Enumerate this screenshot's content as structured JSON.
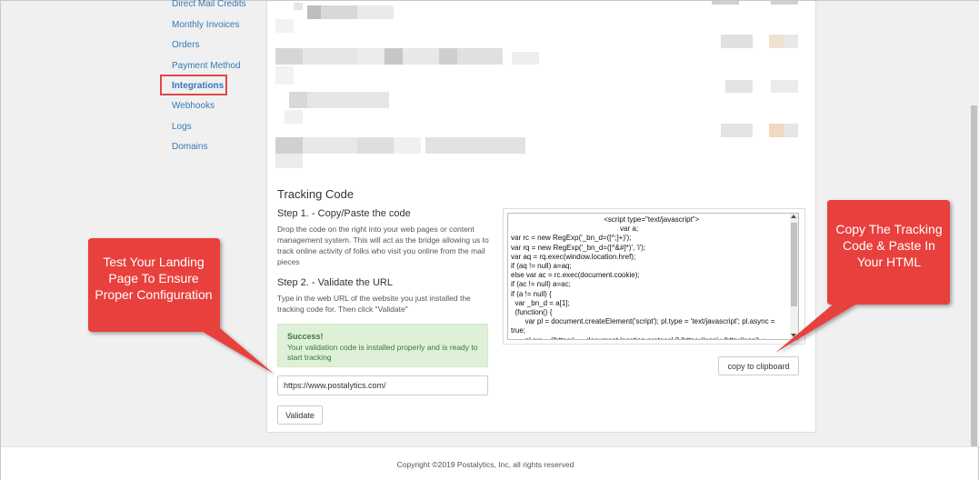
{
  "sidebar": {
    "items": [
      {
        "label": "Direct Mail Credits"
      },
      {
        "label": "Monthly Invoices"
      },
      {
        "label": "Orders"
      },
      {
        "label": "Payment Method"
      },
      {
        "label": "Integrations",
        "active": true
      },
      {
        "label": "Webhooks"
      },
      {
        "label": "Logs"
      },
      {
        "label": "Domains"
      }
    ]
  },
  "tracking": {
    "title": "Tracking Code",
    "step1_title": "Step 1. - Copy/Paste the code",
    "step1_desc": "Drop the code on the right into your web pages or content management system. This will act as the bridge allowing us to track online activity of folks who visit you online from the mail pieces",
    "step2_title": "Step 2. - Validate the URL",
    "step2_desc": "Type in the web URL of the website you just installed the tracking code for. Then click \"Validate\"",
    "success_title": "Success!",
    "success_text": "Your validation code is installed properly and is ready to start tracking",
    "url_value": "https://www.postalytics.com/",
    "validate_label": "Validate",
    "copy_label": "copy to clipboard",
    "code": "                                              <script type=\"text/javascript\">\n                                                      var a;\nvar rc = new RegExp('_bn_d=([^;]+)');\nvar rq = new RegExp('_bn_d=([^&#]*)', 'i');\nvar aq = rq.exec(window.location.href);\nif (aq != null) a=aq;\nelse var ac = rc.exec(document.cookie);\nif (ac != null) a=ac;\nif (a != null) {\n  var _bn_d = a[1];\n  (function() {\n       var pl = document.createElement('script'); pl.type = 'text/javascript'; pl.async = true;\n       pl.src = ('https:' == document.location.protocol ? 'https://app' : 'http://app') + '.postaladmin.com/plDataEmbed.js';\n       var s = document.getElementsByTagName('script')[0];\ns.parentNode.insertBefore(pl, s);\n  })();\n}"
  },
  "callouts": {
    "left": "Test Your Landing Page To Ensure Proper Configuration",
    "right": "Copy The Tracking Code & Paste In Your HTML"
  },
  "footer": {
    "copyright": "Copyright ©2019 Postalytics, Inc, all rights reserved"
  },
  "colors": {
    "link": "#337ab7",
    "callout_red": "#e8403e",
    "highlight_box": "#e0484b",
    "success_bg": "#dff0d8"
  }
}
